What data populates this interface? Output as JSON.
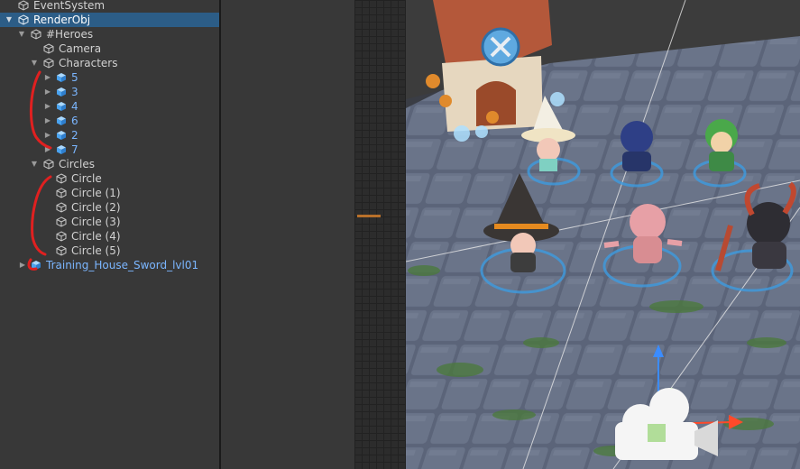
{
  "hierarchy": {
    "items": [
      {
        "label": "EventSystem"
      },
      {
        "label": "RenderObj"
      },
      {
        "label": "#Heroes"
      },
      {
        "label": "Camera"
      },
      {
        "label": "Characters"
      },
      {
        "label": "5"
      },
      {
        "label": "3"
      },
      {
        "label": "4"
      },
      {
        "label": "6"
      },
      {
        "label": "2"
      },
      {
        "label": "7"
      },
      {
        "label": "Circles"
      },
      {
        "label": "Circle"
      },
      {
        "label": "Circle (1)"
      },
      {
        "label": "Circle (2)"
      },
      {
        "label": "Circle (3)"
      },
      {
        "label": "Circle (4)"
      },
      {
        "label": "Circle (5)"
      },
      {
        "label": "Training_House_Sword_lvl01"
      }
    ]
  },
  "colors": {
    "panel": "#383838",
    "selection": "#2c5d87",
    "prefab_text": "#7bb6ff",
    "annotation_red": "#e02020"
  },
  "scene": {
    "characters": [
      "witch",
      "ninja",
      "elf",
      "wizard",
      "pig",
      "demon"
    ],
    "gizmo": [
      "y-axis-arrow",
      "x-axis-arrow",
      "camera-icon"
    ]
  }
}
